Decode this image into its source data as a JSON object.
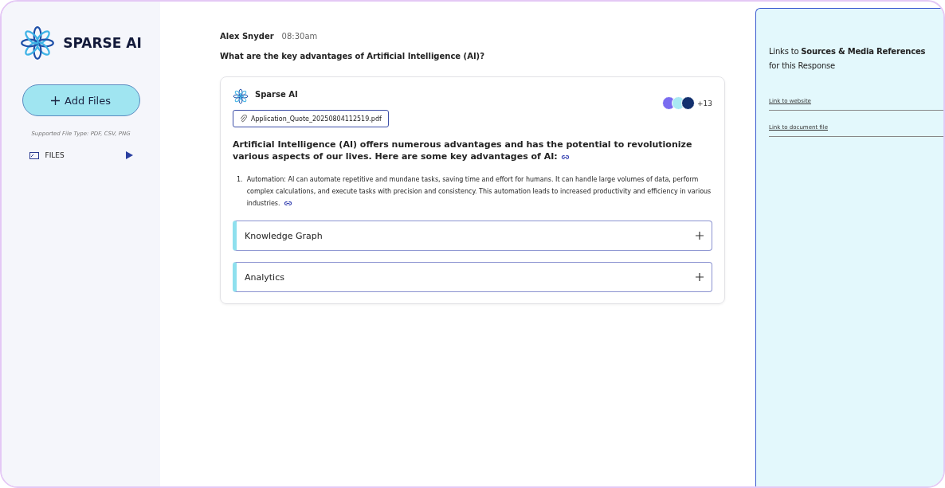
{
  "sidebar": {
    "brand": "SPARSE AI",
    "add_button": "Add Files",
    "supported_types": "Supported File Type: PDF, CSV, PNG",
    "items": [
      {
        "label": "FILES",
        "expanded": false
      }
    ]
  },
  "chat": {
    "user": {
      "name": "Alex Snyder",
      "time": "08:30am",
      "question": "What are the key advantages of Artificial Intelligence (AI)?"
    },
    "response": {
      "author": "Sparse AI",
      "extra_sources": "+13",
      "attachment": "Application_Quote_20250804112519.pdf",
      "intro": "Artificial Intelligence (AI) offers numerous advantages and has the potential to revolutionize various aspects of our lives. Here are some key advantages of AI:",
      "points": [
        {
          "number": "1.",
          "text": "Automation: AI can automate repetitive and mundane tasks, saving time and effort for humans. It can handle large volumes of data, perform complex calculations, and execute tasks with precision and consistency. This automation leads to increased productivity and efficiency in various industries."
        }
      ],
      "sections": [
        {
          "title": "Knowledge Graph",
          "expanded": false
        },
        {
          "title": "Analytics",
          "expanded": false
        }
      ]
    }
  },
  "references": {
    "heading": "Links to **Sources & Media References** for this Response",
    "links": [
      "Link to website",
      "Link to document file"
    ]
  }
}
